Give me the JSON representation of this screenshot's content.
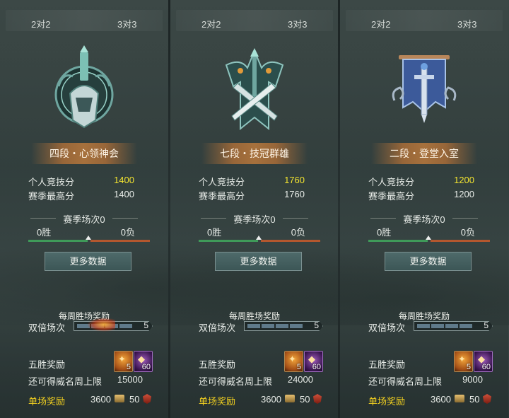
{
  "panels": [
    {
      "tabs": [
        "2对2",
        "3对3"
      ],
      "rank": "四段・心领神会",
      "score_label": "个人竞技分",
      "score": "1400",
      "best_label": "赛季最高分",
      "best": "1400",
      "season_label": "赛季场次0",
      "wins": "0胜",
      "losses": "0负",
      "more_btn": "更多数据",
      "weekly_title": "每周胜场奖励",
      "double_label": "双倍场次",
      "double_count": "5",
      "five_label": "五胜奖励",
      "item1_count": "5",
      "item2_count": "60",
      "limit_label": "还可得威名周上限",
      "limit": "15000",
      "single_label": "单场奖励",
      "single_v1": "3600",
      "single_v2": "50"
    },
    {
      "tabs": [
        "2对2",
        "3对3"
      ],
      "rank": "七段・技冠群雄",
      "score_label": "个人竞技分",
      "score": "1760",
      "best_label": "赛季最高分",
      "best": "1760",
      "season_label": "赛季场次0",
      "wins": "0胜",
      "losses": "0负",
      "more_btn": "更多数据",
      "weekly_title": "每周胜场奖励",
      "double_label": "双倍场次",
      "double_count": "5",
      "five_label": "五胜奖励",
      "item1_count": "5",
      "item2_count": "60",
      "limit_label": "还可得威名周上限",
      "limit": "24000",
      "single_label": "单场奖励",
      "single_v1": "3600",
      "single_v2": "50"
    },
    {
      "tabs": [
        "2对2",
        "3对3"
      ],
      "rank": "二段・登堂入室",
      "score_label": "个人竞技分",
      "score": "1200",
      "best_label": "赛季最高分",
      "best": "1200",
      "season_label": "赛季场次0",
      "wins": "0胜",
      "losses": "0负",
      "more_btn": "更多数据",
      "weekly_title": "每周胜场奖励",
      "double_label": "双倍场次",
      "double_count": "5",
      "five_label": "五胜奖励",
      "item1_count": "5",
      "item2_count": "60",
      "limit_label": "还可得威名周上限",
      "limit": "9000",
      "single_label": "单场奖励",
      "single_v1": "3600",
      "single_v2": "50"
    }
  ],
  "colors": {
    "score_yellow": "#f2e330",
    "single_label": "#f2d020",
    "win_green": "#3f9a59",
    "loss_red": "#b4572e"
  }
}
